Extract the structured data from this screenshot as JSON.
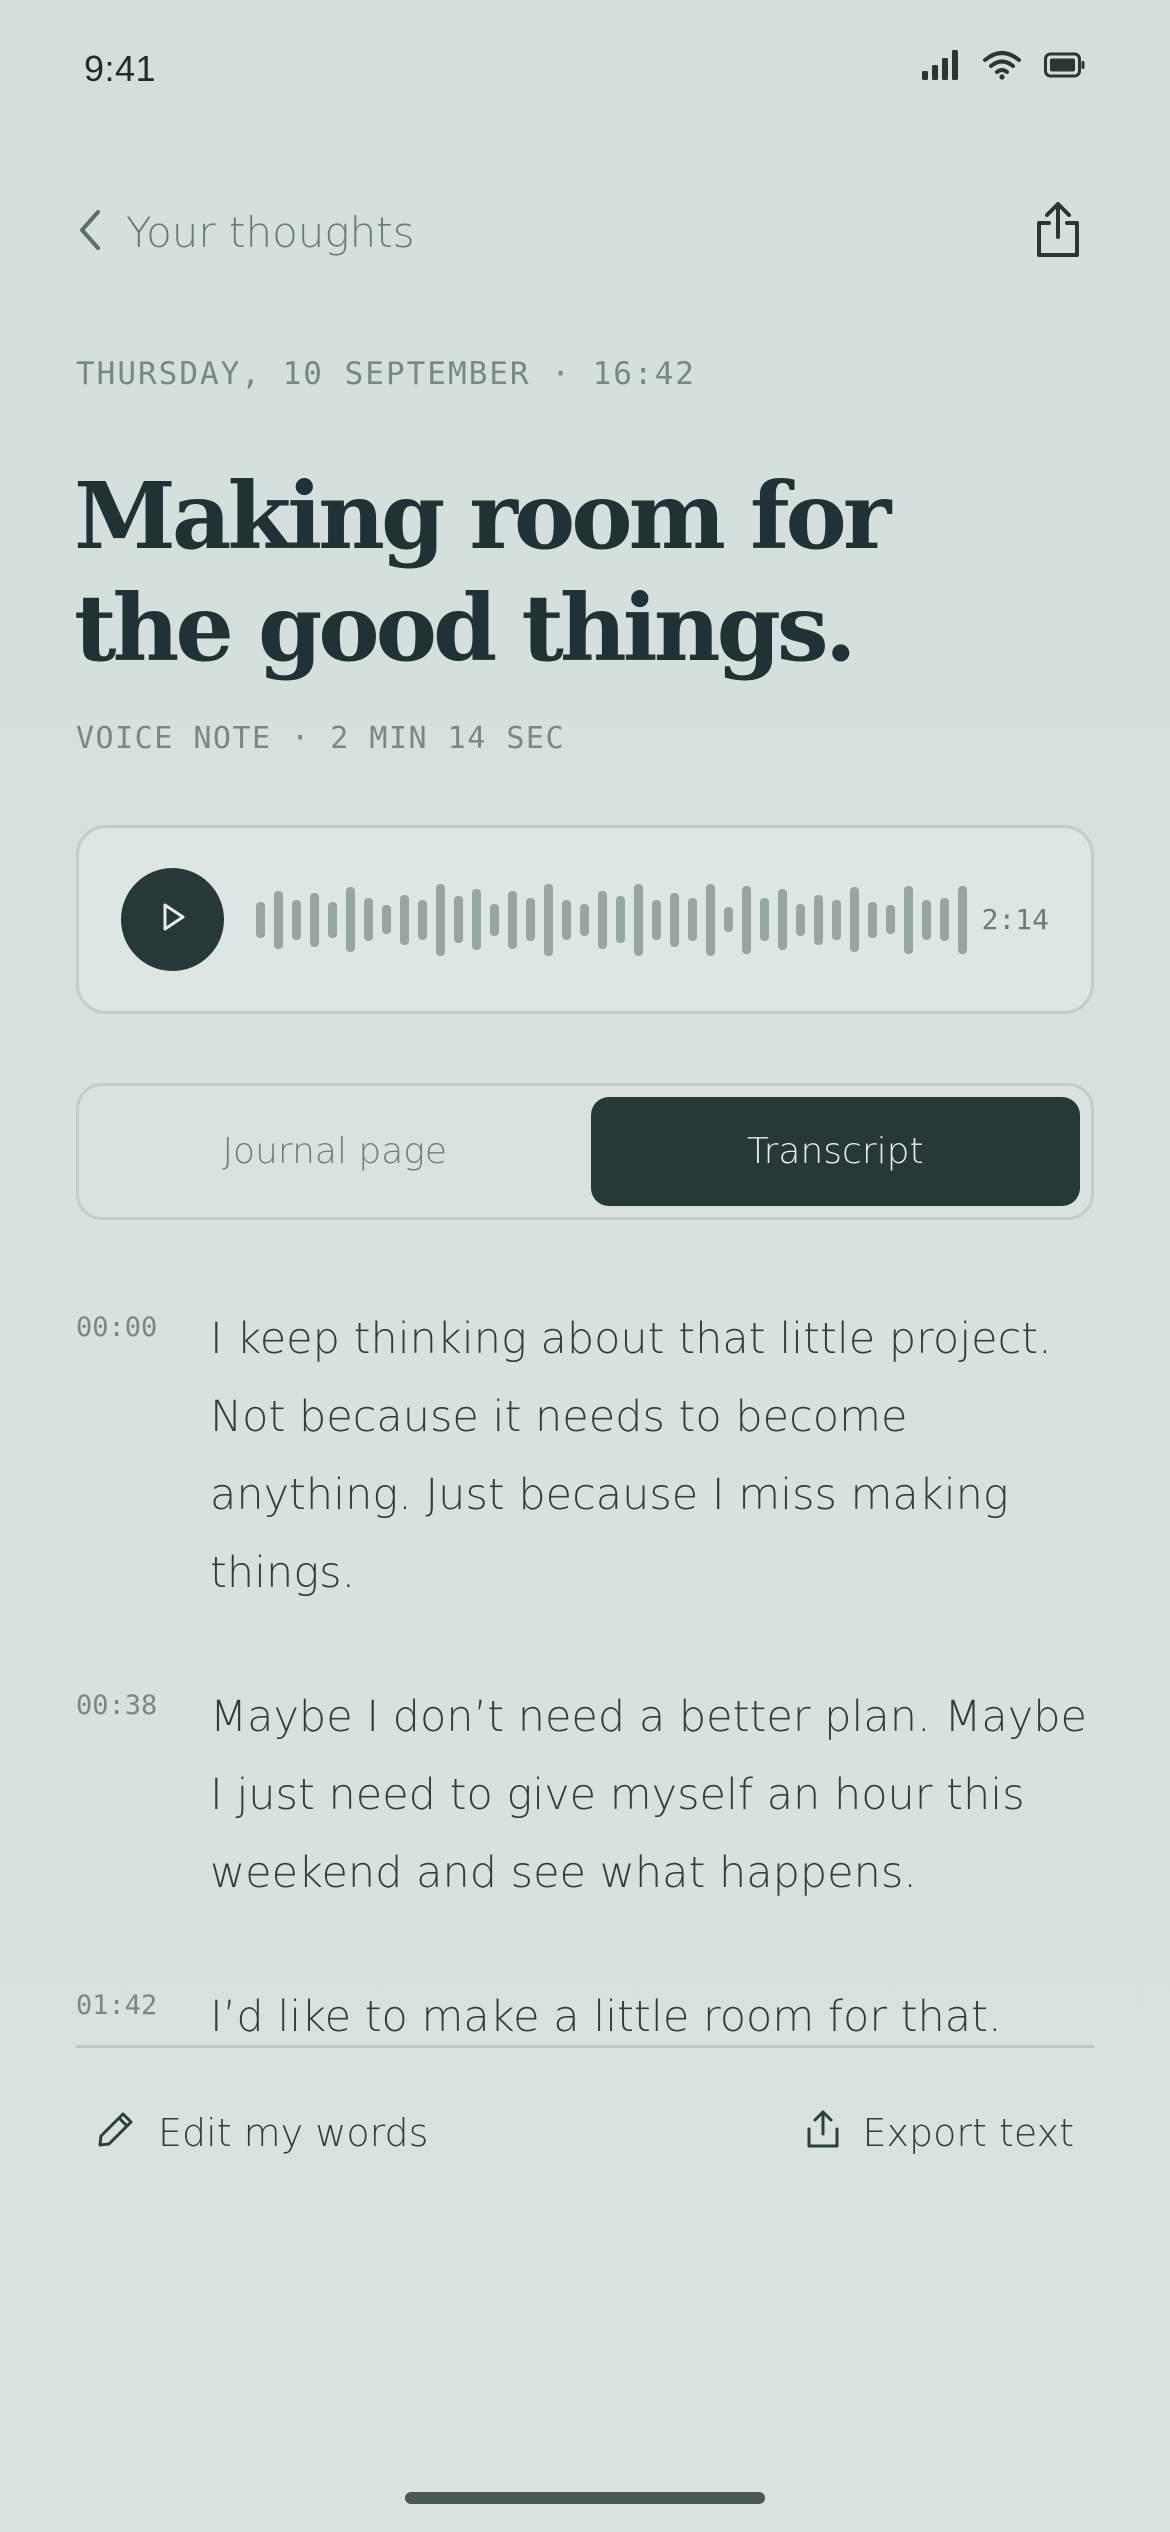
{
  "status_bar": {
    "time": "9:41",
    "icons": [
      "cellular-signal-icon",
      "wifi-icon",
      "battery-icon"
    ]
  },
  "nav": {
    "back_icon": "chevron-left-icon",
    "back_label": "Your thoughts",
    "share_icon": "share-icon"
  },
  "entry": {
    "date_line": "THURSDAY, 10 SEPTEMBER · 16:42",
    "title": "Making room for the good things.",
    "voice_meta": "VOICE NOTE · 2 MIN 14 SEC"
  },
  "player": {
    "play_icon": "play-icon",
    "duration": "2:14",
    "waveform_levels": [
      0.5,
      0.8,
      0.55,
      0.75,
      0.5,
      0.9,
      0.6,
      0.4,
      0.7,
      0.55,
      1.0,
      0.65,
      0.85,
      0.45,
      0.8,
      0.6,
      1.0,
      0.55,
      0.45,
      0.8,
      0.65,
      1.0,
      0.55,
      0.75,
      0.6,
      1.0,
      0.35,
      0.95,
      0.6,
      0.85,
      0.45,
      0.7,
      0.55,
      0.9,
      0.5,
      0.4,
      0.95,
      0.55,
      0.6,
      0.95
    ]
  },
  "tabs": [
    {
      "label": "Journal page",
      "active": false
    },
    {
      "label": "Transcript",
      "active": true
    }
  ],
  "transcript": [
    {
      "time": "00:00",
      "text": "I keep thinking about that little project. Not because it needs to become anything. Just because I miss making things."
    },
    {
      "time": "00:38",
      "text": "Maybe I don’t need a better plan. Maybe I just need to give myself an hour this weekend and see what happens."
    },
    {
      "time": "01:42",
      "text": "I’d like to make a little room for that."
    }
  ],
  "actions": {
    "edit_icon": "pencil-icon",
    "edit_label": "Edit my words",
    "export_icon": "export-icon",
    "export_label": "Export text"
  },
  "colors": {
    "background": "#d5e0df",
    "ink": "#283839",
    "muted": "#7a8789"
  }
}
